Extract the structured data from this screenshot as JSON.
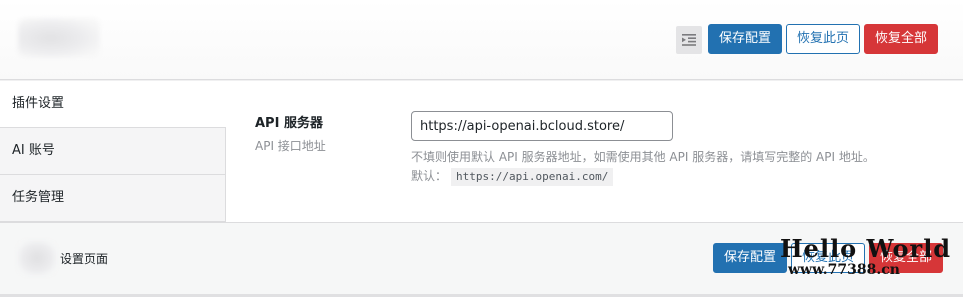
{
  "header": {
    "collapse_icon": "indent-icon",
    "save_label": "保存配置",
    "restore_page_label": "恢复此页",
    "restore_all_label": "恢复全部"
  },
  "nav": {
    "items": [
      {
        "label": "插件设置",
        "active": true
      },
      {
        "label": "AI 账号",
        "active": false
      },
      {
        "label": "任务管理",
        "active": false
      }
    ]
  },
  "field": {
    "label": "API 服务器",
    "sublabel": "API 接口地址",
    "value": "https://api-openai.bcloud.store/",
    "description": "不填则使用默认 API 服务器地址，如需使用其他 API 服务器，请填写完整的 API 地址。",
    "default_prefix": "默认：",
    "default_value": "https://api.openai.com/"
  },
  "footer": {
    "title": "设置页面",
    "save_label": "保存配置",
    "restore_page_label": "恢复此页",
    "restore_all_label": "恢复全部"
  },
  "watermark": {
    "line1": "Hello World",
    "line2": "www.77388.cn"
  },
  "colors": {
    "primary": "#2271b1",
    "danger": "#d63638"
  }
}
